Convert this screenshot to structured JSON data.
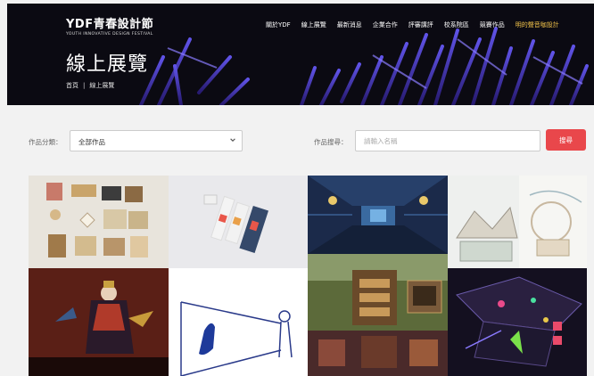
{
  "header": {
    "logo_main": "YDF青春設計節",
    "logo_sub": "YOUTH INNOVATIVE DESIGN FESTIVAL",
    "nav": [
      {
        "label": "關於YDF",
        "active": false
      },
      {
        "label": "線上展覽",
        "active": false
      },
      {
        "label": "最新消息",
        "active": false
      },
      {
        "label": "企業合作",
        "active": false
      },
      {
        "label": "評審講評",
        "active": false
      },
      {
        "label": "校系院區",
        "active": false
      },
      {
        "label": "競賽作品",
        "active": false
      },
      {
        "label": "明的聲音咖設計",
        "active": true
      }
    ],
    "page_title": "線上展覽",
    "breadcrumb": [
      "首頁",
      "線上展覽"
    ]
  },
  "filters": {
    "category_label": "作品分類：",
    "category_value": "全部作品",
    "search_label": "作品搜尋：",
    "search_placeholder": "請輸入名稱",
    "search_button": "搜尋"
  },
  "gallery": {
    "tiles": [
      {
        "name": "craft-objects-tile",
        "palette": "#e8e4dc"
      },
      {
        "name": "product-packaging-tile",
        "palette": "#e9e9ec"
      },
      {
        "name": "game-corridor-tile",
        "palette": "#1b2a4a"
      },
      {
        "name": "architecture-sketch-tile",
        "palette": "#eef0ee"
      },
      {
        "name": "puppet-figure-tile",
        "palette": "#5a1f16"
      },
      {
        "name": "line-illustration-tile",
        "palette": "#ffffff"
      },
      {
        "name": "game-village-tile",
        "palette": "#5c6a3a"
      },
      {
        "name": "neon-installation-tile",
        "palette": "#141020"
      }
    ]
  },
  "colors": {
    "accent": "#e9474b",
    "nav_active": "#f0c24a",
    "banner_bg": "#0b0a12"
  }
}
